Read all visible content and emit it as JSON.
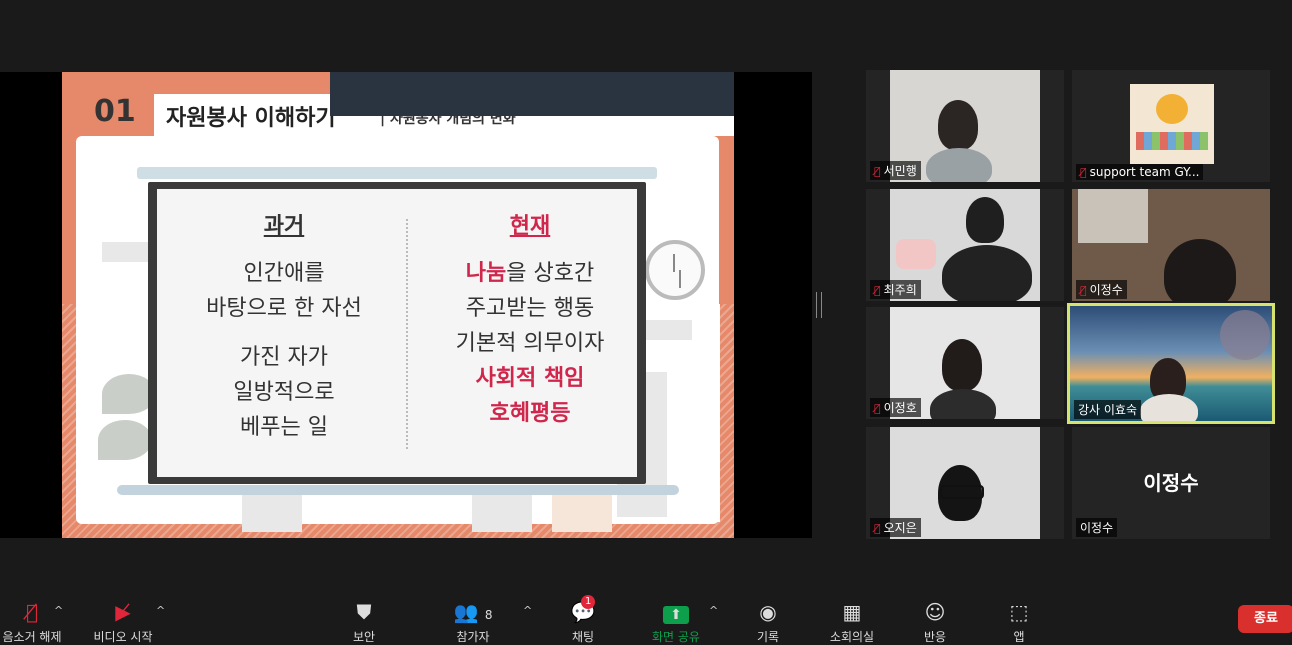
{
  "slide": {
    "number": "01",
    "title": "자원봉사 이해하기",
    "subtitle": "| 자원봉사 개념의 변화",
    "left_heading": "과거",
    "left_lines": [
      "인간애를",
      "바탕으로 한 자선",
      "가진 자가",
      "일방적으로",
      "베푸는 일"
    ],
    "right_heading": "현재",
    "right_lines": [
      {
        "parts": [
          {
            "text": "나눔",
            "highlight": true
          },
          {
            "text": "을 상호간",
            "highlight": false
          }
        ]
      },
      {
        "parts": [
          {
            "text": "주고받는 행동",
            "highlight": false
          }
        ]
      },
      {
        "parts": [
          {
            "text": "기본적 의무이자",
            "highlight": false
          }
        ]
      },
      {
        "parts": [
          {
            "text": "사회적 책임",
            "highlight": true
          }
        ]
      },
      {
        "parts": [
          {
            "text": "호혜평등",
            "highlight": true
          }
        ]
      }
    ]
  },
  "participants": [
    {
      "name": "서민행",
      "muted": true,
      "video": "camera"
    },
    {
      "name": "support team GY...",
      "muted": true,
      "video": "logo"
    },
    {
      "name": "최주희",
      "muted": true,
      "video": "camera"
    },
    {
      "name": "이정수",
      "muted": true,
      "video": "camera"
    },
    {
      "name": "이정호",
      "muted": true,
      "video": "camera"
    },
    {
      "name": "강사 이효숙",
      "muted": false,
      "video": "camera",
      "active_speaker": true
    },
    {
      "name": "오지은",
      "muted": true,
      "video": "camera"
    },
    {
      "name": "이정수",
      "muted": false,
      "video": "off",
      "display_name": "이정수"
    }
  ],
  "toolbar": {
    "mute_label": "음소거 해제",
    "video_label": "비디오 시작",
    "security_label": "보안",
    "participants_label": "참가자",
    "participants_count": "8",
    "chat_label": "채팅",
    "chat_badge": "1",
    "share_label": "화면 공유",
    "record_label": "기록",
    "breakout_label": "소회의실",
    "reactions_label": "반응",
    "apps_label": "앱",
    "end_label": "종료"
  },
  "colors": {
    "accent": "#d0264b",
    "speaker_border": "#d7e36f",
    "end_button": "#d9302d",
    "share_icon": "#0e9f4d"
  }
}
